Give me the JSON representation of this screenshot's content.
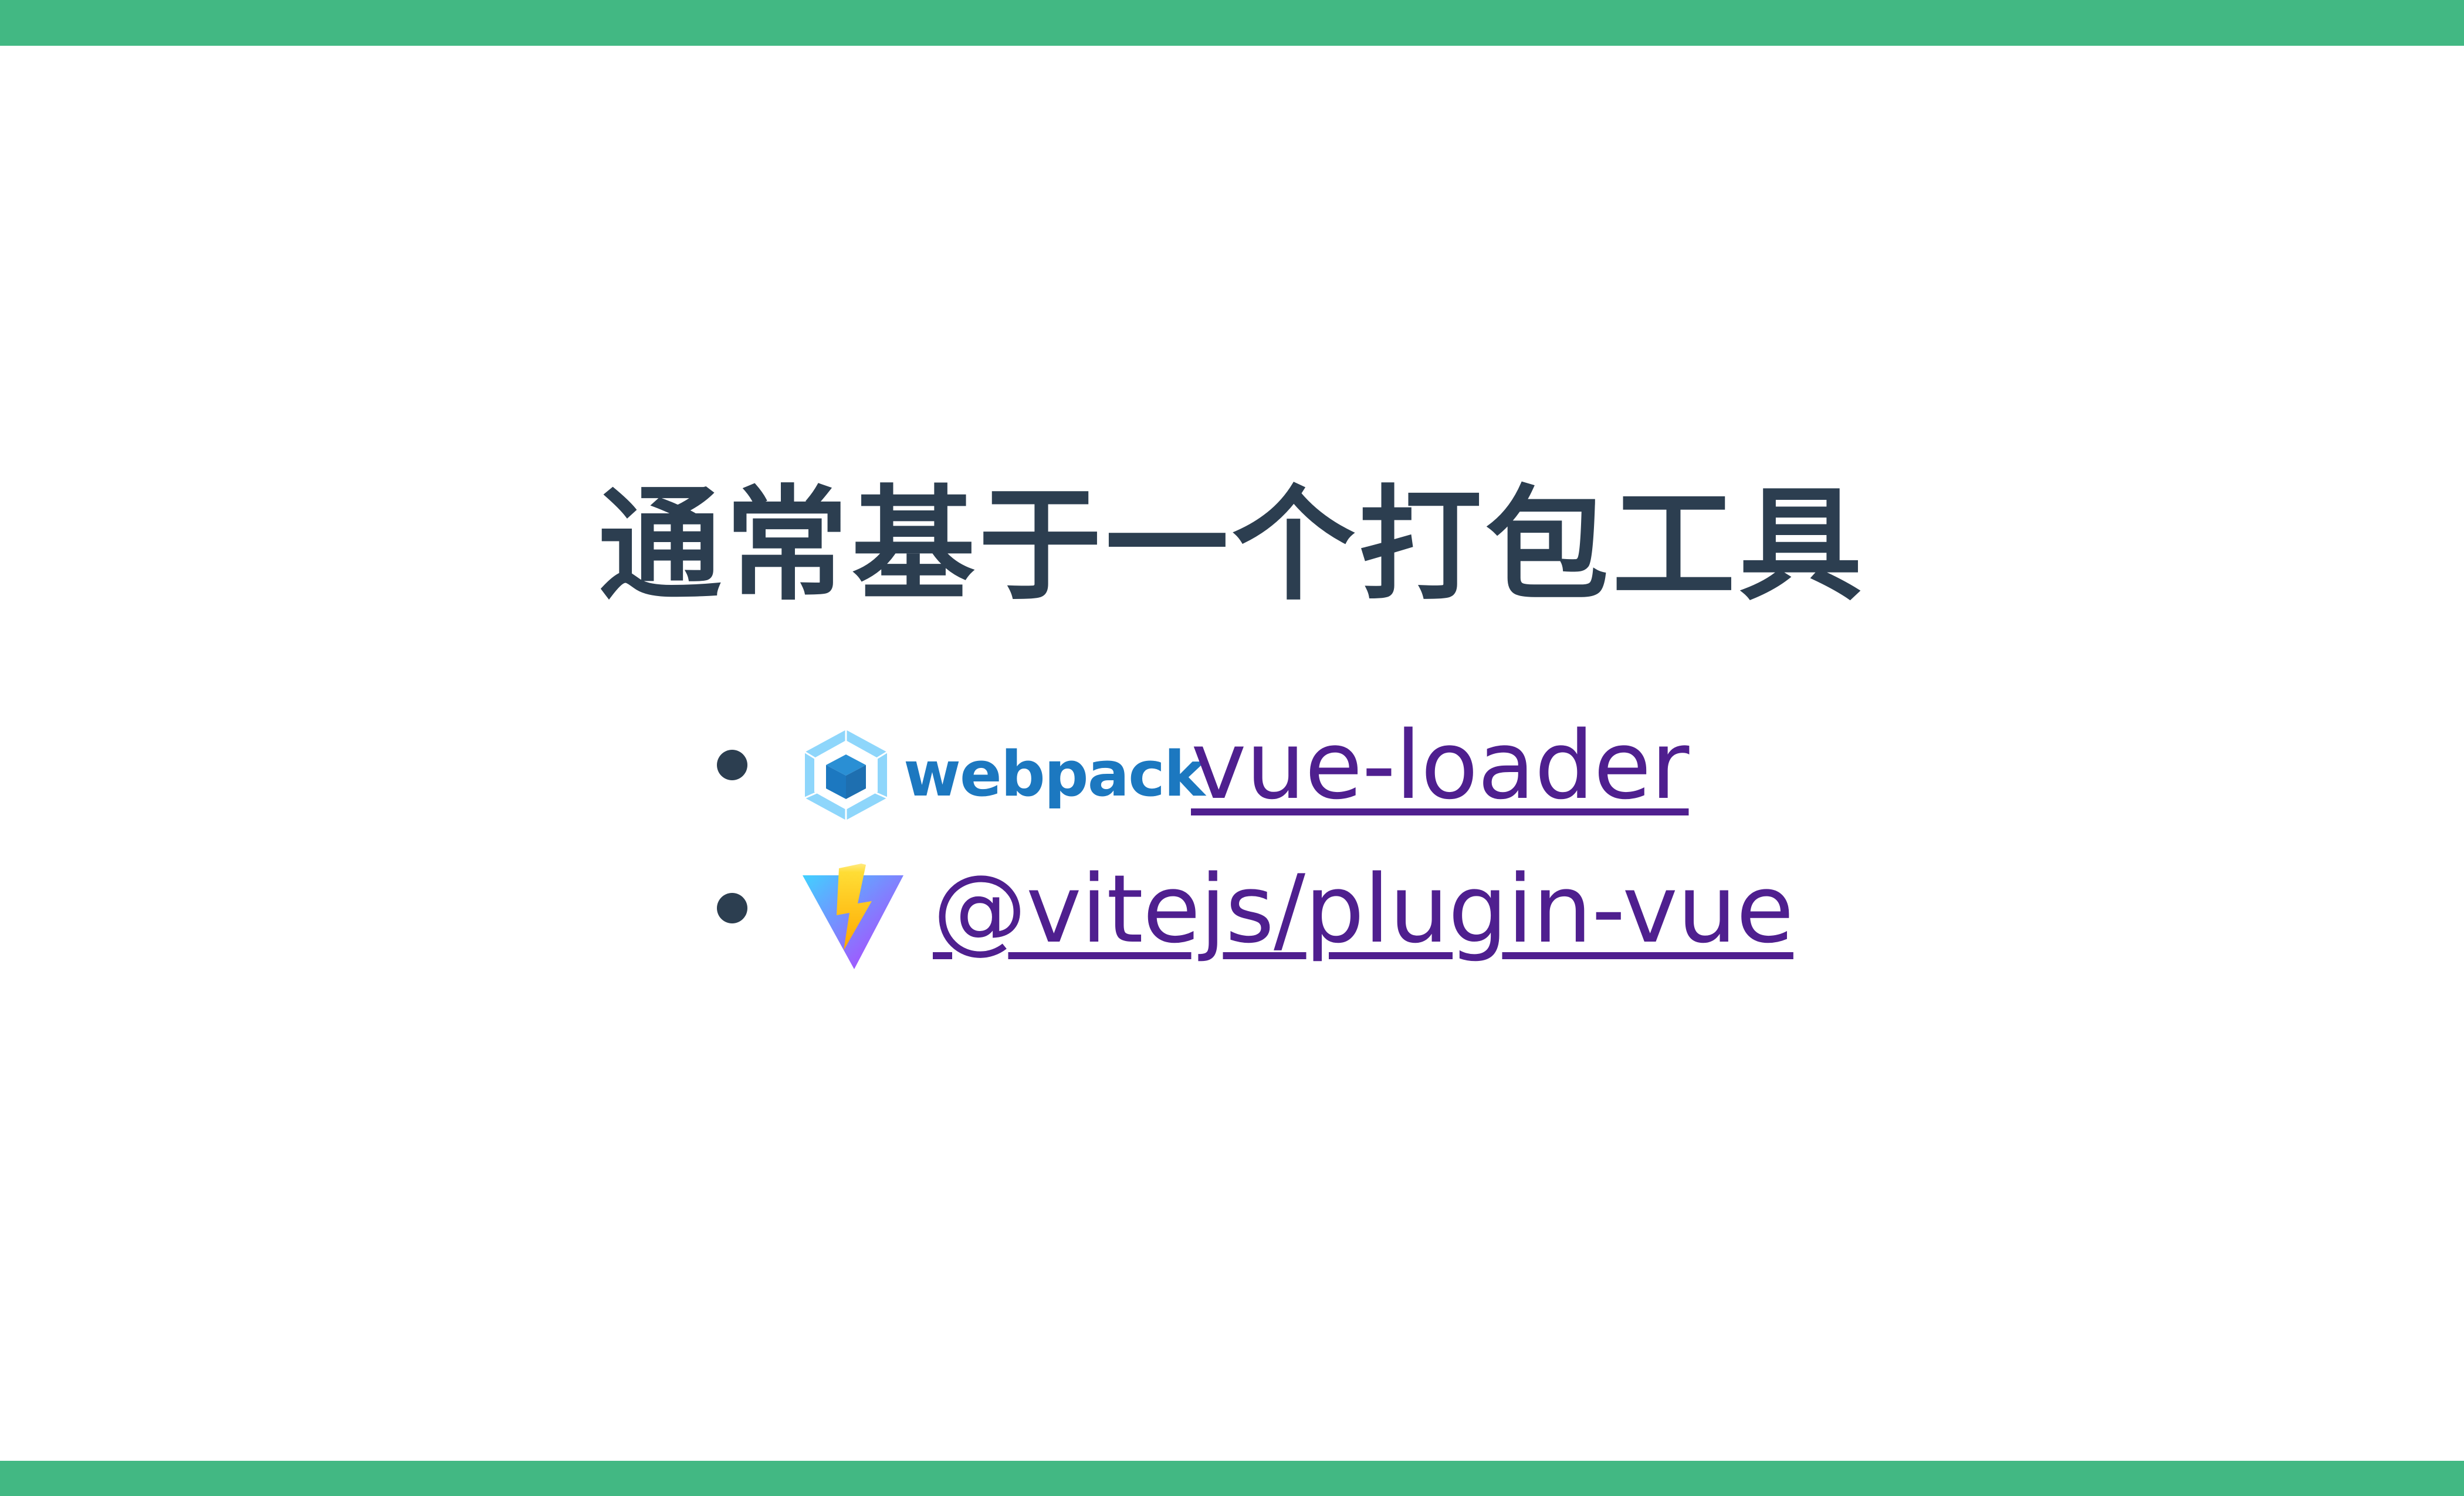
{
  "slide": {
    "title": "通常基于一个打包工具",
    "accent_color": "#42b883",
    "title_color": "#2c3e50",
    "link_color": "#4f1f8f"
  },
  "bullets": [
    {
      "icon": "webpack-logo-icon",
      "brand_text": "webpack",
      "link_text": "vue-loader"
    },
    {
      "icon": "vite-logo-icon",
      "link_text": "@vitejs/plugin-vue"
    }
  ]
}
